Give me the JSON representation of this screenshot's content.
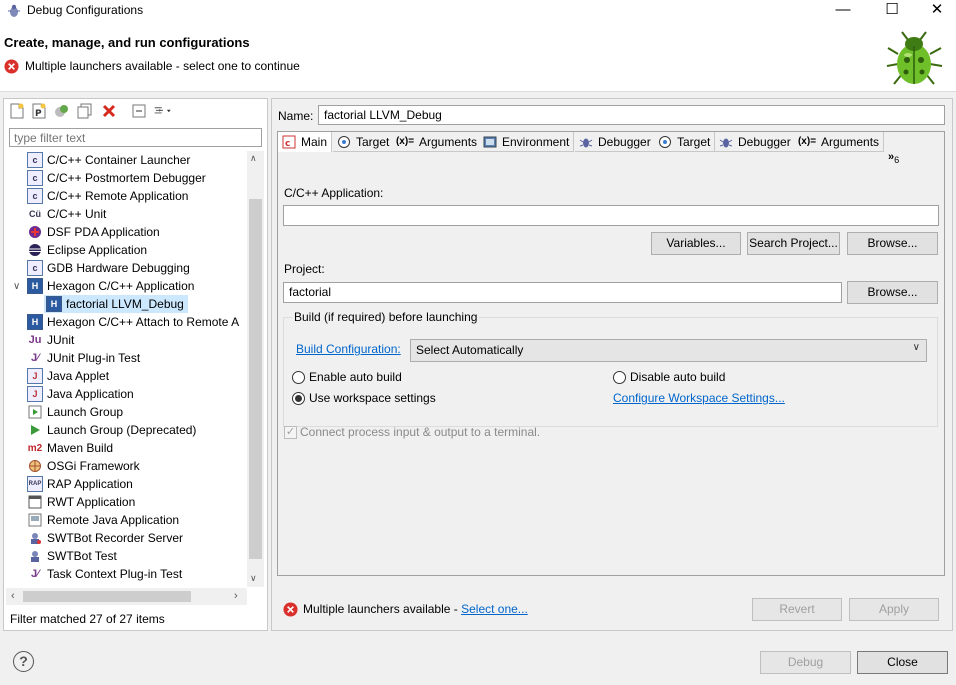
{
  "window": {
    "title": "Debug Configurations",
    "minimize_label": "—",
    "maximize_label": "☐",
    "close_label": "✕"
  },
  "header": {
    "title": "Create, manage, and run configurations",
    "message": "Multiple launchers available - select one to continue"
  },
  "left": {
    "filter_placeholder": "type filter text",
    "tree": [
      {
        "label": "C/C++ Container Launcher",
        "icon": "c-app-icon"
      },
      {
        "label": "C/C++ Postmortem Debugger",
        "icon": "c-app-icon"
      },
      {
        "label": "C/C++ Remote Application",
        "icon": "c-app-icon"
      },
      {
        "label": "C/C++ Unit",
        "icon": "c-unit-icon"
      },
      {
        "label": "DSF PDA Application",
        "icon": "pda-icon"
      },
      {
        "label": "Eclipse Application",
        "icon": "eclipse-icon"
      },
      {
        "label": "GDB Hardware Debugging",
        "icon": "c-app-icon"
      },
      {
        "label": "Hexagon C/C++ Application",
        "icon": "hexagon-icon"
      },
      {
        "label": "factorial LLVM_Debug",
        "icon": "hexagon-icon"
      },
      {
        "label": "Hexagon C/C++ Attach to Remote A",
        "icon": "hexagon-icon"
      },
      {
        "label": "JUnit",
        "icon": "junit-icon"
      },
      {
        "label": "JUnit Plug-in Test",
        "icon": "junit-plugin-icon"
      },
      {
        "label": "Java Applet",
        "icon": "java-applet-icon"
      },
      {
        "label": "Java Application",
        "icon": "java-app-icon"
      },
      {
        "label": "Launch Group",
        "icon": "launch-group-icon"
      },
      {
        "label": "Launch Group (Deprecated)",
        "icon": "launch-group-deprecated-icon"
      },
      {
        "label": "Maven Build",
        "icon": "maven-icon"
      },
      {
        "label": "OSGi Framework",
        "icon": "osgi-icon"
      },
      {
        "label": "RAP Application",
        "icon": "rap-icon"
      },
      {
        "label": "RWT Application",
        "icon": "rwt-icon"
      },
      {
        "label": "Remote Java Application",
        "icon": "remote-java-icon"
      },
      {
        "label": "SWTBot Recorder Server",
        "icon": "swtbot-recorder-icon"
      },
      {
        "label": "SWTBot Test",
        "icon": "swtbot-test-icon"
      },
      {
        "label": "Task Context Plug-in Test",
        "icon": "task-context-icon"
      }
    ],
    "filter_status": "Filter matched 27 of 27 items"
  },
  "right": {
    "name_label": "Name:",
    "name_value": "factorial LLVM_Debug",
    "tabs": [
      {
        "label": "Main",
        "icon": "main-tab-icon"
      },
      {
        "label": "Target",
        "icon": "target-tab-icon"
      },
      {
        "label": "Arguments",
        "icon": "arguments-tab-icon"
      },
      {
        "label": "Environment",
        "icon": "environment-tab-icon"
      },
      {
        "label": "Debugger",
        "icon": "debugger-tab-icon"
      },
      {
        "label": "Target",
        "icon": "target-tab-icon"
      },
      {
        "label": "Debugger",
        "icon": "debugger-tab-icon"
      },
      {
        "label": "Arguments",
        "icon": "arguments-tab-icon"
      }
    ],
    "tab_overflow": "»",
    "tab_overflow_count": "6",
    "app_label": "C/C++ Application:",
    "app_value": "",
    "variables_btn": "Variables...",
    "search_project_btn": "Search Project...",
    "browse_btn": "Browse...",
    "project_label": "Project:",
    "project_value": "factorial",
    "project_browse_btn": "Browse...",
    "build_group_title": "Build (if required) before launching",
    "build_config_link": "Build Configuration:",
    "build_config_value": "Select Automatically",
    "enable_auto_build": "Enable auto build",
    "disable_auto_build": "Disable auto build",
    "use_workspace_settings": "Use workspace settings",
    "configure_workspace_link": "Configure Workspace Settings...",
    "connect_terminal": "Connect process input & output to a terminal.",
    "bottom_msg": "Multiple launchers available - ",
    "select_one_link": "Select one...",
    "revert_btn": "Revert",
    "apply_btn": "Apply"
  },
  "footer": {
    "debug_btn": "Debug",
    "close_btn": "Close"
  }
}
